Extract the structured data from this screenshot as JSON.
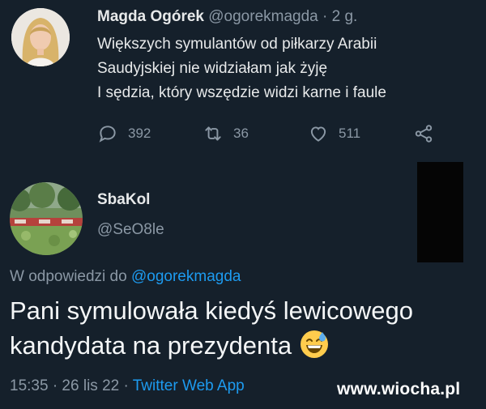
{
  "original_tweet": {
    "display_name": "Magda Ogórek",
    "handle": "@ogorekmagda",
    "time_ago": "· 2 g.",
    "lines": [
      "Większych symulantów od piłkarzy Arabii",
      "Saudyjskiej nie widziałam jak żyję",
      "I sędzia, który wszędzie widzi karne i faule"
    ],
    "stats": {
      "replies": "392",
      "retweets": "36",
      "likes": "511"
    }
  },
  "reply_tweet": {
    "display_name": "SbaKol",
    "handle": "@SeO8le",
    "reply_label": "W odpowiedzi do",
    "reply_to": "@ogorekmagda",
    "text_line1": "Pani symulowała kiedyś lewicowego",
    "text_line2": "kandydata na prezydenta",
    "emoji": "grinning-face-with-sweat",
    "timestamp": "15:35 · 26 lis 22 ·",
    "source_app": "Twitter Web App"
  },
  "watermark": "www.wiocha.pl",
  "colors": {
    "background": "#15202b",
    "text": "#e7e9ea",
    "secondary": "#8b98a5",
    "accent": "#1d9bf0"
  }
}
